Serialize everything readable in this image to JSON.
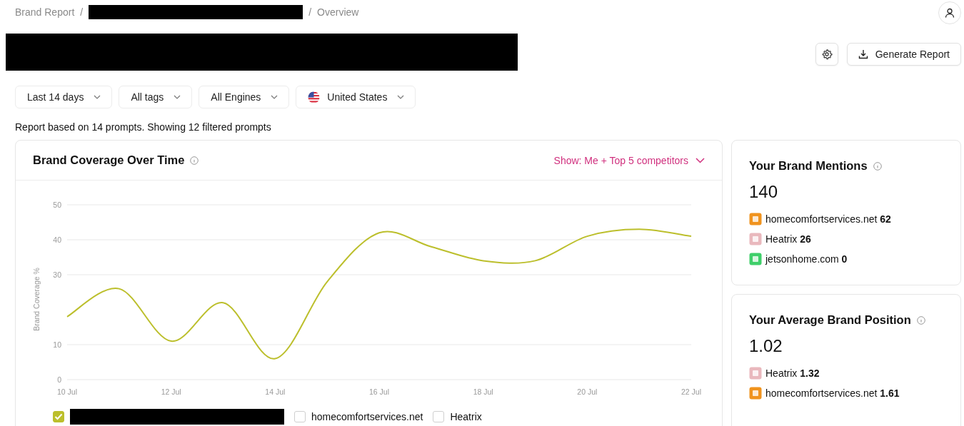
{
  "breadcrumb_separator": "/",
  "breadcrumb": [
    {
      "kind": "link",
      "label": "Brand Report"
    },
    {
      "kind": "redacted"
    },
    {
      "kind": "current",
      "label": "Overview"
    }
  ],
  "page_title": {
    "redacted": true
  },
  "actions": {
    "generate_label": "Generate Report"
  },
  "filters": [
    {
      "kind": "plain",
      "label": "Last 14 days"
    },
    {
      "kind": "plain",
      "label": "All tags"
    },
    {
      "kind": "plain",
      "label": "All Engines"
    },
    {
      "kind": "country",
      "label": "United States"
    }
  ],
  "summary": "Report based on 14 prompts. Showing 12 filtered prompts",
  "coverage": {
    "title": "Brand Coverage Over Time",
    "show_selector": "Show: Me + Top 5 competitors",
    "chart_data": {
      "type": "line",
      "ylabel": "Brand Coverage %",
      "categories": [
        "10 Jul",
        null,
        "12 Jul",
        null,
        "14 Jul",
        null,
        "16 Jul",
        null,
        "18 Jul",
        null,
        "20 Jul",
        null,
        "22 Jul"
      ],
      "grid": true,
      "series": [
        {
          "color": "#bcbf2c",
          "values": [
            18,
            26,
            11,
            22,
            6,
            28,
            42,
            38,
            34,
            34,
            41,
            43,
            41
          ]
        }
      ],
      "yticks": [
        0,
        10,
        30,
        40,
        50
      ],
      "ylim": [
        0,
        50
      ]
    },
    "legend": [
      {
        "kind": "redacted",
        "checked": true
      },
      {
        "kind": "named",
        "label": "homecomfortservices.net",
        "checked": false
      },
      {
        "kind": "named",
        "label": "Heatrix",
        "checked": false
      }
    ]
  },
  "cards": [
    {
      "title": "Your Brand Mentions",
      "value": "140",
      "rows": [
        {
          "name": "homecomfortservices.net",
          "metric": "62",
          "color": "#f0931e"
        },
        {
          "name": "Heatrix",
          "metric": "26",
          "color": "#e9b8bd"
        },
        {
          "name": "jetsonhome.com",
          "metric": "0",
          "color": "#3fcf6a"
        }
      ]
    },
    {
      "title": "Your Average Brand Position",
      "value": "1.02",
      "rows": [
        {
          "name": "Heatrix",
          "metric": "1.32",
          "color": "#e9b8bd"
        },
        {
          "name": "homecomfortservices.net",
          "metric": "1.61",
          "color": "#f0931e"
        }
      ]
    }
  ]
}
